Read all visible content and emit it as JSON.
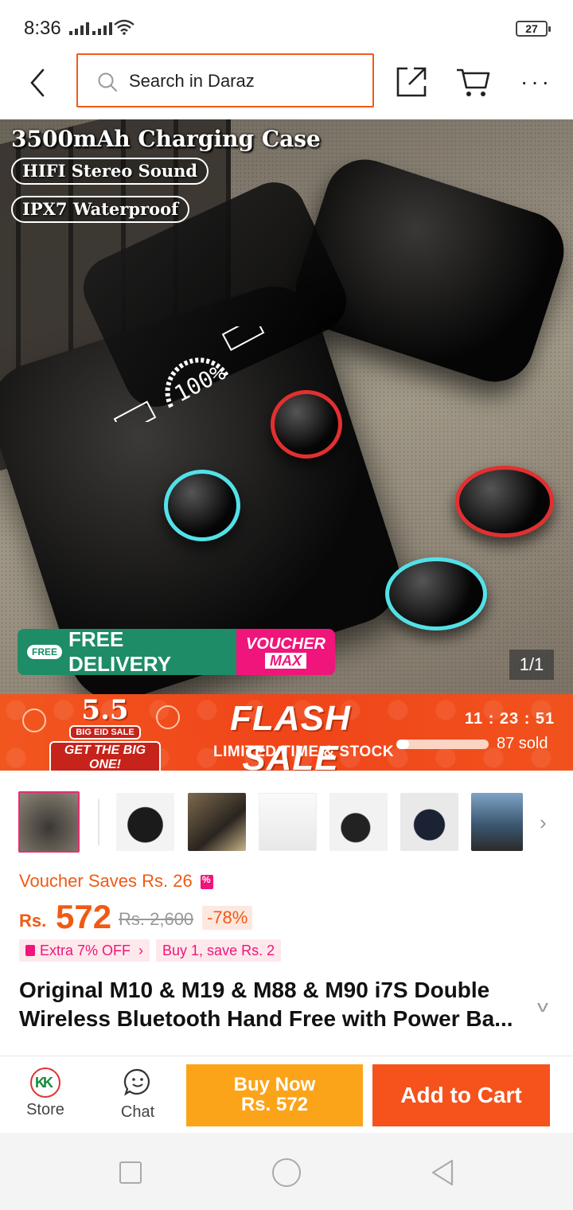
{
  "status": {
    "time": "8:36",
    "battery": "27"
  },
  "header": {
    "search_placeholder": "Search in Daraz"
  },
  "hero": {
    "headline": "3500mAh Charging Case",
    "pill1": "HIFI Stereo Sound",
    "pill2": "IPX7 Waterproof",
    "free_badge": "FREE",
    "free_delivery": "FREE DELIVERY",
    "voucher_top": "VOUCHER",
    "voucher_max": "MAX",
    "counter": "1/1"
  },
  "flash": {
    "eid_number": "5.5",
    "eid_sale": "BIG EID SALE",
    "eid_tagline": "GET THE BIG ONE!",
    "title": "FLASH SALE",
    "subtitle": "LIMITED TIME & STOCK",
    "countdown": "11 : 23 : 51",
    "progress_fraction": 0.14,
    "sold": "87 sold"
  },
  "product": {
    "voucher_saves": "Voucher Saves Rs. 26",
    "currency": "Rs.",
    "price": "572",
    "original_price": "Rs. 2,600",
    "discount": "-78%",
    "chip_extra": "Extra 7% OFF",
    "chip_buy": "Buy 1, save Rs. 2",
    "title": "Original M10 & M19 & M88 & M90 i7S Double Wireless Bluetooth Hand Free with Power Ba..."
  },
  "actions": {
    "store": "Store",
    "chat": "Chat",
    "buy_now_line1": "Buy Now",
    "buy_now_line2": "Rs. 572",
    "add_to_cart": "Add to Cart"
  },
  "colors": {
    "brand": "#f05a14",
    "pink": "#f0157a",
    "buy": "#fca419",
    "cart": "#f5521c"
  }
}
